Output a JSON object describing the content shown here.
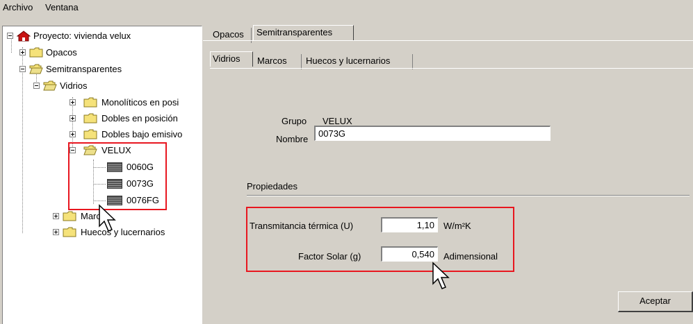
{
  "menu": {
    "file": "Archivo",
    "window": "Ventana"
  },
  "tree": {
    "root": "Proyecto: vivienda velux",
    "opacos": "Opacos",
    "semitransparentes": "Semitransparentes",
    "vidrios": "Vidrios",
    "monoliticos": "Monolíticos en posi",
    "dobles": "Dobles en posición",
    "dobles_bajo": "Dobles bajo emisivo",
    "velux": "VELUX",
    "items": [
      "0060G",
      "0073G",
      "0076FG"
    ],
    "marcos": "Marcos",
    "huecos": "Huecos y lucernarios"
  },
  "tabs_top": [
    "Opacos",
    "Semitransparentes"
  ],
  "tabs_sub": [
    "Vidrios",
    "Marcos",
    "Huecos y lucernarios"
  ],
  "form": {
    "grupo_label": "Grupo",
    "grupo_value": "VELUX",
    "nombre_label": "Nombre",
    "nombre_value": "0073G",
    "propiedades": "Propiedades",
    "u_label": "Transmitancia térmica (U)",
    "u_value": "1,10",
    "u_unit": "W/m²K",
    "g_label": "Factor Solar (g)",
    "g_value": "0,540",
    "g_unit": "Adimensional",
    "accept": "Aceptar"
  },
  "colors": {
    "highlight_box": "#e8161f",
    "panel": "#d4d0c8"
  }
}
